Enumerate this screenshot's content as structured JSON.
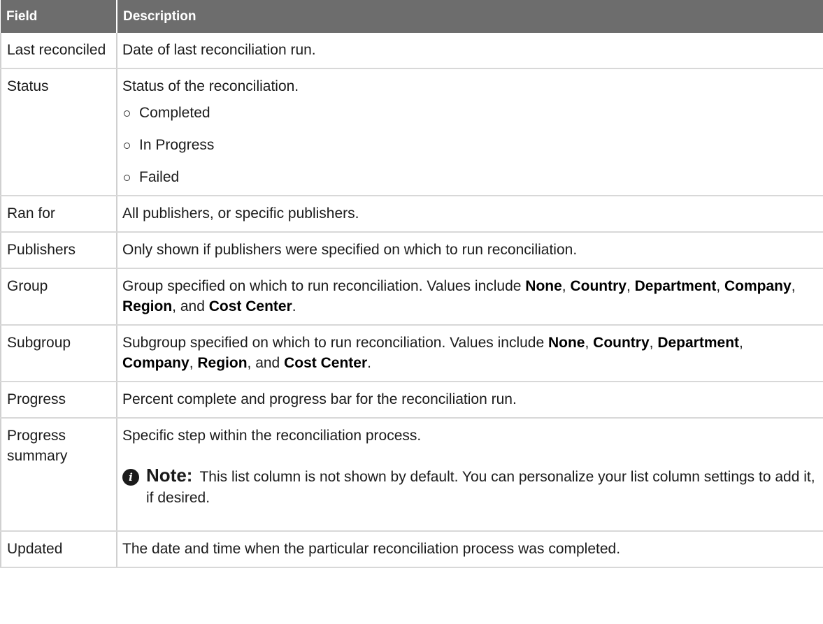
{
  "header": {
    "field": "Field",
    "description": "Description"
  },
  "rows": [
    {
      "field": "Last reconciled",
      "description": "Date of last reconciliation run."
    },
    {
      "field": "Status",
      "description": "Status of the reconciliation.",
      "options": [
        "Completed",
        "In Progress",
        "Failed"
      ]
    },
    {
      "field": "Ran for",
      "description": "All publishers, or specific publishers."
    },
    {
      "field": "Publishers",
      "description": "Only shown if publishers were specified on which to run reconciliation."
    },
    {
      "field": "Group",
      "desc_prefix": "Group specified on which to run reconciliation. Values include ",
      "values": [
        "None",
        "Country",
        "Department",
        "Company",
        "Region",
        "Cost Center"
      ],
      "and": "and"
    },
    {
      "field": "Subgroup",
      "desc_prefix": "Subgroup specified on which to run reconciliation. Values include ",
      "values": [
        "None",
        "Country",
        "Department",
        "Company",
        "Region",
        "Cost Center"
      ],
      "and": "and"
    },
    {
      "field": "Progress",
      "description": "Percent complete and progress bar for the reconciliation run."
    },
    {
      "field": "Progress summary",
      "description": "Specific step within the reconciliation process.",
      "note": {
        "title": "Note:",
        "text": "This list column is not shown by default. You can personalize your list column settings to add it, if desired."
      }
    },
    {
      "field": "Updated",
      "description": "The date and time when the particular reconciliation process was completed."
    }
  ]
}
